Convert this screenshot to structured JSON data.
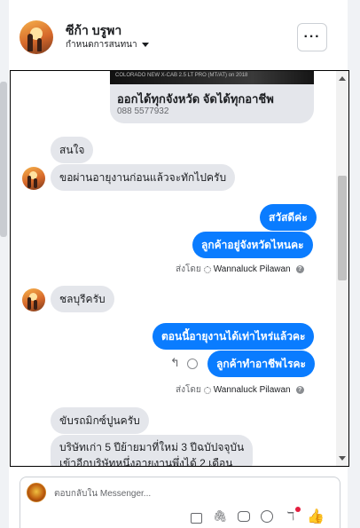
{
  "contact": {
    "name": "ซีก้า บรูพา",
    "subtitle": "กำหนดการสนทนา"
  },
  "header": {
    "more_label": "···"
  },
  "ad_card": {
    "banner_text": "COLORADO NEW X-CAB 2.5 LT PRO (MT/AT) on 2018",
    "title": "ออกได้ทุกจังหวัด จัดได้ทุกอาชีพ",
    "phone": "088 5577932"
  },
  "messages": {
    "m1": "สนใจ",
    "m2": "ขอผ่านอายุงานก่อนแล้วจะทักไปครับ",
    "m3": "สวัสดีค่ะ",
    "m4": "ลูกค้าอยู่จังหวัดไหนคะ",
    "m5": "ชลบุรีครับ",
    "m6": "ตอนนี้อายุงานได้เท่าไหร่แล้วคะ",
    "m7": "ลูกค้าทำอาชีพไรคะ",
    "m8": "ขับรถมิกซ์ปูนครับ",
    "m9_line1": "บริษัทเก่า 5 ปีย้ายมาที่ใหม่ 3 ปีฉบัปจจุบัน",
    "m9_line2": "เข้าอีกบริษัทหนึ่งอายุงานพึ่งได้ 2 เดือน"
  },
  "sent_by": {
    "label": "ส่งโดย",
    "agent": "Wannaluck Pilawan",
    "help": "?"
  },
  "composer": {
    "placeholder": "ตอบกลับใน Messenger..."
  },
  "icons": {
    "reply": "reply-icon",
    "react": "smile-icon",
    "send_like": "thumbs-up-icon"
  },
  "colors": {
    "outgoing": "#0a7cff",
    "incoming": "#e4e6eb"
  }
}
